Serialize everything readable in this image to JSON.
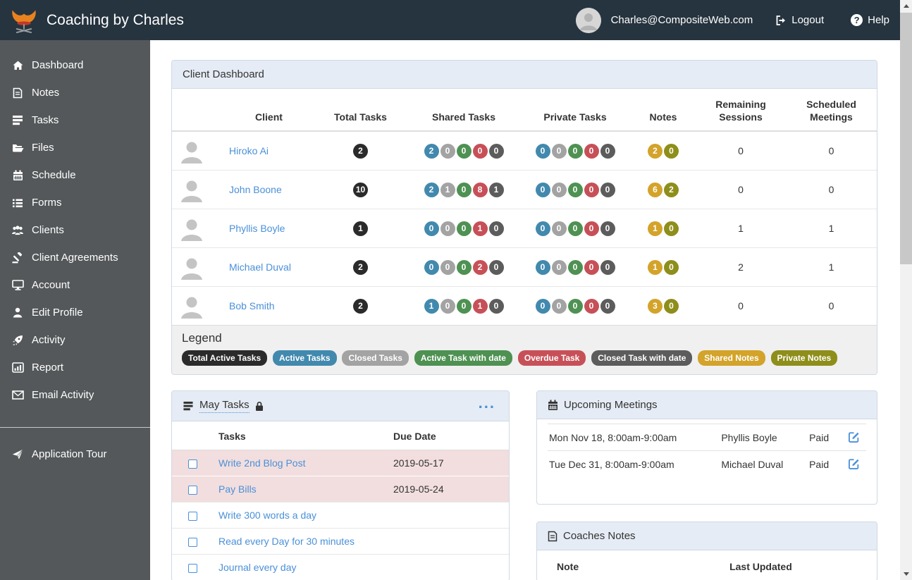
{
  "navbar": {
    "brand": "Coaching by Charles",
    "user_email": "Charles@CompositeWeb.com",
    "logout_label": "Logout",
    "help_label": "Help"
  },
  "sidebar": {
    "items": [
      {
        "icon": "home-icon",
        "label": "Dashboard"
      },
      {
        "icon": "notes-icon",
        "label": "Notes"
      },
      {
        "icon": "tasks-icon",
        "label": "Tasks"
      },
      {
        "icon": "folder-icon",
        "label": "Files"
      },
      {
        "icon": "calendar-icon",
        "label": "Schedule"
      },
      {
        "icon": "list-icon",
        "label": "Forms"
      },
      {
        "icon": "users-icon",
        "label": "Clients"
      },
      {
        "icon": "gavel-icon",
        "label": "Client Agreements"
      },
      {
        "icon": "monitor-icon",
        "label": "Account"
      },
      {
        "icon": "user-icon",
        "label": "Edit Profile"
      },
      {
        "icon": "rocket-icon",
        "label": "Activity"
      },
      {
        "icon": "chart-icon",
        "label": "Report"
      },
      {
        "icon": "envelope-icon",
        "label": "Email Activity"
      }
    ],
    "tour_label": "Application Tour"
  },
  "dashboard": {
    "title": "Client Dashboard",
    "columns": [
      "Client",
      "Total Tasks",
      "Shared Tasks",
      "Private Tasks",
      "Notes",
      "Remaining Sessions",
      "Scheduled Meetings"
    ],
    "rows": [
      {
        "client": "Hiroko Ai",
        "total": "2",
        "shared": [
          "2",
          "0",
          "0",
          "0",
          "0"
        ],
        "private": [
          "0",
          "0",
          "0",
          "0",
          "0"
        ],
        "notes": [
          "2",
          "0"
        ],
        "sessions": "0",
        "meetings": "0"
      },
      {
        "client": "John Boone",
        "total": "10",
        "shared": [
          "2",
          "1",
          "0",
          "8",
          "1"
        ],
        "private": [
          "0",
          "0",
          "0",
          "0",
          "0"
        ],
        "notes": [
          "6",
          "2"
        ],
        "sessions": "0",
        "meetings": "0"
      },
      {
        "client": "Phyllis Boyle",
        "total": "1",
        "shared": [
          "0",
          "0",
          "0",
          "1",
          "0"
        ],
        "private": [
          "0",
          "0",
          "0",
          "0",
          "0"
        ],
        "notes": [
          "1",
          "0"
        ],
        "sessions": "1",
        "meetings": "1"
      },
      {
        "client": "Michael Duval",
        "total": "2",
        "shared": [
          "0",
          "0",
          "0",
          "2",
          "0"
        ],
        "private": [
          "0",
          "0",
          "0",
          "0",
          "0"
        ],
        "notes": [
          "1",
          "0"
        ],
        "sessions": "2",
        "meetings": "1"
      },
      {
        "client": "Bob Smith",
        "total": "2",
        "shared": [
          "1",
          "0",
          "0",
          "1",
          "0"
        ],
        "private": [
          "0",
          "0",
          "0",
          "0",
          "0"
        ],
        "notes": [
          "3",
          "0"
        ],
        "sessions": "0",
        "meetings": "0"
      }
    ],
    "legend": {
      "title": "Legend",
      "badges": [
        {
          "label": "Total Active Tasks",
          "color": "#2b2b2b"
        },
        {
          "label": "Active Tasks",
          "color": "#4289ae"
        },
        {
          "label": "Closed Tasks",
          "color": "#a3a3a3"
        },
        {
          "label": "Active Task with date",
          "color": "#4e9152"
        },
        {
          "label": "Overdue Task",
          "color": "#c75058"
        },
        {
          "label": "Closed Task with date",
          "color": "#5c5c5c"
        },
        {
          "label": "Shared Notes",
          "color": "#d3a32a"
        },
        {
          "label": "Private Notes",
          "color": "#8e8e1b"
        }
      ]
    }
  },
  "may_tasks": {
    "title": "May Tasks",
    "menu_label": "...",
    "columns": [
      "Tasks",
      "Due Date"
    ],
    "rows": [
      {
        "task": "Write 2nd Blog Post",
        "due": "2019-05-17",
        "overdue": true
      },
      {
        "task": "Pay Bills",
        "due": "2019-05-24",
        "overdue": true
      },
      {
        "task": "Write 300 words a day",
        "due": "",
        "overdue": false
      },
      {
        "task": "Read every Day for 30 minutes",
        "due": "",
        "overdue": false
      },
      {
        "task": "Journal every day",
        "due": "",
        "overdue": false
      }
    ]
  },
  "meetings": {
    "title": "Upcoming Meetings",
    "rows": [
      {
        "when": "Mon Nov 18, 8:00am-9:00am",
        "client": "Phyllis Boyle",
        "status": "Paid"
      },
      {
        "when": "Tue Dec 31, 8:00am-9:00am",
        "client": "Michael Duval",
        "status": "Paid"
      }
    ]
  },
  "coaches_notes": {
    "title": "Coaches Notes",
    "columns": [
      "Note",
      "Last Updated"
    ]
  },
  "colors": {
    "navbar_bg": "#26343f",
    "sidebar_bg": "#54585a",
    "link_blue": "#4a90d9",
    "panel_heading_bg": "#e5ecf5",
    "overdue_row_bg": "#f2dede",
    "logo_orange": "#e8821e",
    "logo_red": "#c0392b"
  }
}
